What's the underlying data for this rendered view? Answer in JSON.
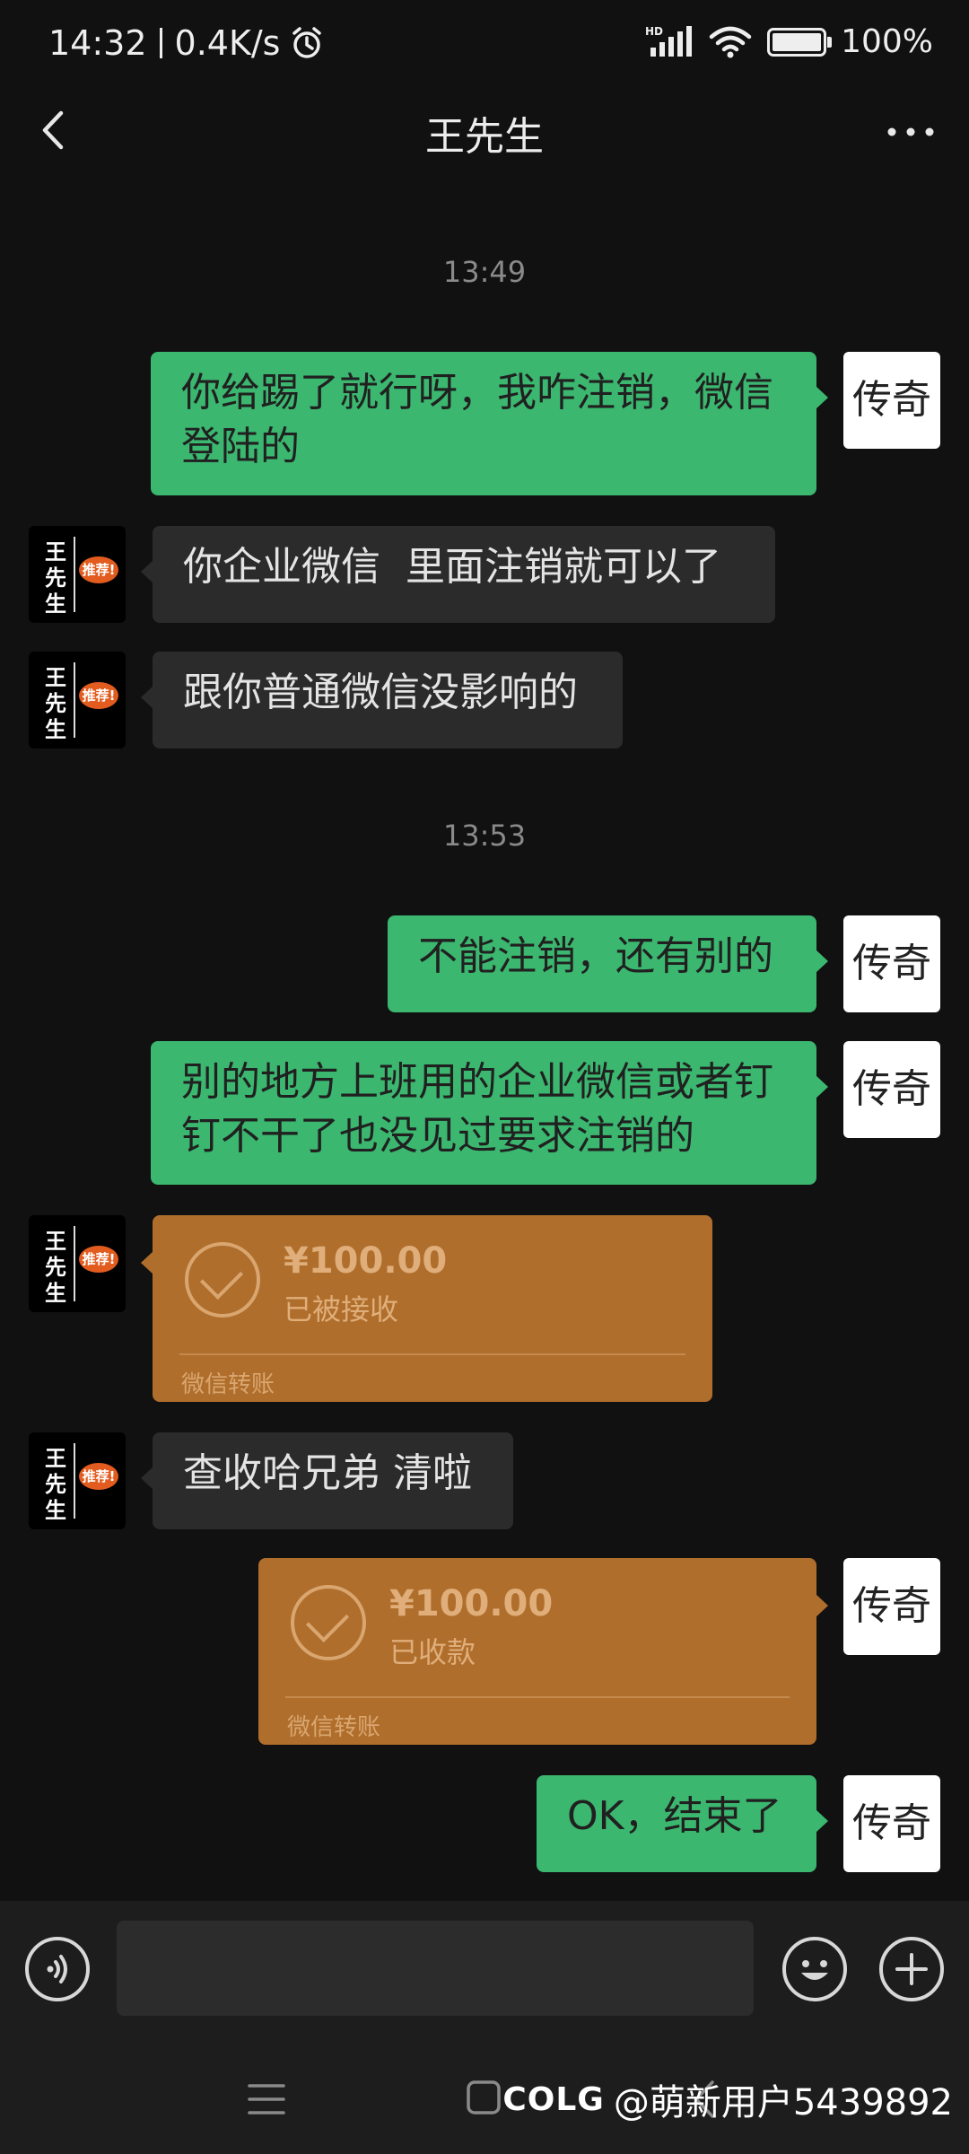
{
  "status_bar": {
    "time": "14:32",
    "speed": "0.4K/s",
    "network": "HD",
    "battery": "100%"
  },
  "header": {
    "title": "王先生"
  },
  "contact_avatar": {
    "text": "王先生",
    "badge": "推荐!"
  },
  "my_avatar": {
    "text": "传奇"
  },
  "messages": [
    {
      "type": "time",
      "text": "13:49"
    },
    {
      "type": "text",
      "from": "me",
      "text": "你给踢了就行呀，我咋注销，微信登陆的"
    },
    {
      "type": "text",
      "from": "other",
      "text": "你企业微信  里面注销就可以了"
    },
    {
      "type": "text",
      "from": "other",
      "text": "跟你普通微信没影响的"
    },
    {
      "type": "time",
      "text": "13:53"
    },
    {
      "type": "text",
      "from": "me",
      "text": "不能注销，还有别的"
    },
    {
      "type": "text",
      "from": "me",
      "text": "别的地方上班用的企业微信或者钉钉不干了也没见过要求注销的"
    },
    {
      "type": "transfer",
      "from": "other",
      "amount": "¥100.00",
      "status": "已被接收",
      "label": "微信转账"
    },
    {
      "type": "text",
      "from": "other",
      "text": "查收哈兄弟 清啦"
    },
    {
      "type": "transfer",
      "from": "me",
      "amount": "¥100.00",
      "status": "已收款",
      "label": "微信转账"
    },
    {
      "type": "text",
      "from": "me",
      "text": "OK，结束了"
    }
  ],
  "input": {
    "value": "",
    "placeholder": ""
  },
  "watermark": {
    "logo": "COLG",
    "text": "@萌新用户5439892"
  },
  "colors": {
    "sent_bubble": "#3bb76f",
    "received_bubble": "#2b2b2b",
    "transfer_card": "#b06e2c",
    "background": "#111111"
  },
  "icons": [
    "back-arrow-icon",
    "more-dots-icon",
    "voice-icon",
    "emoji-icon",
    "plus-icon",
    "checkmark-icon",
    "menu-icon",
    "home-icon",
    "back-icon",
    "wifi-icon",
    "signal-icon",
    "alarm-icon",
    "battery-icon"
  ]
}
